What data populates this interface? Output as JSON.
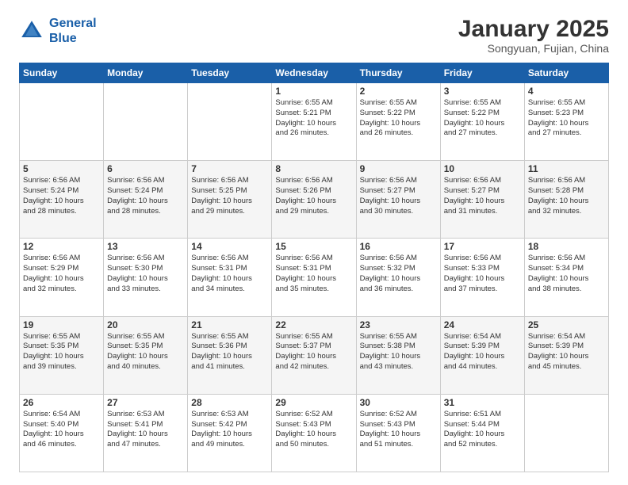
{
  "header": {
    "logo_line1": "General",
    "logo_line2": "Blue",
    "month": "January 2025",
    "location": "Songyuan, Fujian, China"
  },
  "weekdays": [
    "Sunday",
    "Monday",
    "Tuesday",
    "Wednesday",
    "Thursday",
    "Friday",
    "Saturday"
  ],
  "weeks": [
    [
      {
        "day": "",
        "info": ""
      },
      {
        "day": "",
        "info": ""
      },
      {
        "day": "",
        "info": ""
      },
      {
        "day": "1",
        "info": "Sunrise: 6:55 AM\nSunset: 5:21 PM\nDaylight: 10 hours\nand 26 minutes."
      },
      {
        "day": "2",
        "info": "Sunrise: 6:55 AM\nSunset: 5:22 PM\nDaylight: 10 hours\nand 26 minutes."
      },
      {
        "day": "3",
        "info": "Sunrise: 6:55 AM\nSunset: 5:22 PM\nDaylight: 10 hours\nand 27 minutes."
      },
      {
        "day": "4",
        "info": "Sunrise: 6:55 AM\nSunset: 5:23 PM\nDaylight: 10 hours\nand 27 minutes."
      }
    ],
    [
      {
        "day": "5",
        "info": "Sunrise: 6:56 AM\nSunset: 5:24 PM\nDaylight: 10 hours\nand 28 minutes."
      },
      {
        "day": "6",
        "info": "Sunrise: 6:56 AM\nSunset: 5:24 PM\nDaylight: 10 hours\nand 28 minutes."
      },
      {
        "day": "7",
        "info": "Sunrise: 6:56 AM\nSunset: 5:25 PM\nDaylight: 10 hours\nand 29 minutes."
      },
      {
        "day": "8",
        "info": "Sunrise: 6:56 AM\nSunset: 5:26 PM\nDaylight: 10 hours\nand 29 minutes."
      },
      {
        "day": "9",
        "info": "Sunrise: 6:56 AM\nSunset: 5:27 PM\nDaylight: 10 hours\nand 30 minutes."
      },
      {
        "day": "10",
        "info": "Sunrise: 6:56 AM\nSunset: 5:27 PM\nDaylight: 10 hours\nand 31 minutes."
      },
      {
        "day": "11",
        "info": "Sunrise: 6:56 AM\nSunset: 5:28 PM\nDaylight: 10 hours\nand 32 minutes."
      }
    ],
    [
      {
        "day": "12",
        "info": "Sunrise: 6:56 AM\nSunset: 5:29 PM\nDaylight: 10 hours\nand 32 minutes."
      },
      {
        "day": "13",
        "info": "Sunrise: 6:56 AM\nSunset: 5:30 PM\nDaylight: 10 hours\nand 33 minutes."
      },
      {
        "day": "14",
        "info": "Sunrise: 6:56 AM\nSunset: 5:31 PM\nDaylight: 10 hours\nand 34 minutes."
      },
      {
        "day": "15",
        "info": "Sunrise: 6:56 AM\nSunset: 5:31 PM\nDaylight: 10 hours\nand 35 minutes."
      },
      {
        "day": "16",
        "info": "Sunrise: 6:56 AM\nSunset: 5:32 PM\nDaylight: 10 hours\nand 36 minutes."
      },
      {
        "day": "17",
        "info": "Sunrise: 6:56 AM\nSunset: 5:33 PM\nDaylight: 10 hours\nand 37 minutes."
      },
      {
        "day": "18",
        "info": "Sunrise: 6:56 AM\nSunset: 5:34 PM\nDaylight: 10 hours\nand 38 minutes."
      }
    ],
    [
      {
        "day": "19",
        "info": "Sunrise: 6:55 AM\nSunset: 5:35 PM\nDaylight: 10 hours\nand 39 minutes."
      },
      {
        "day": "20",
        "info": "Sunrise: 6:55 AM\nSunset: 5:35 PM\nDaylight: 10 hours\nand 40 minutes."
      },
      {
        "day": "21",
        "info": "Sunrise: 6:55 AM\nSunset: 5:36 PM\nDaylight: 10 hours\nand 41 minutes."
      },
      {
        "day": "22",
        "info": "Sunrise: 6:55 AM\nSunset: 5:37 PM\nDaylight: 10 hours\nand 42 minutes."
      },
      {
        "day": "23",
        "info": "Sunrise: 6:55 AM\nSunset: 5:38 PM\nDaylight: 10 hours\nand 43 minutes."
      },
      {
        "day": "24",
        "info": "Sunrise: 6:54 AM\nSunset: 5:39 PM\nDaylight: 10 hours\nand 44 minutes."
      },
      {
        "day": "25",
        "info": "Sunrise: 6:54 AM\nSunset: 5:39 PM\nDaylight: 10 hours\nand 45 minutes."
      }
    ],
    [
      {
        "day": "26",
        "info": "Sunrise: 6:54 AM\nSunset: 5:40 PM\nDaylight: 10 hours\nand 46 minutes."
      },
      {
        "day": "27",
        "info": "Sunrise: 6:53 AM\nSunset: 5:41 PM\nDaylight: 10 hours\nand 47 minutes."
      },
      {
        "day": "28",
        "info": "Sunrise: 6:53 AM\nSunset: 5:42 PM\nDaylight: 10 hours\nand 49 minutes."
      },
      {
        "day": "29",
        "info": "Sunrise: 6:52 AM\nSunset: 5:43 PM\nDaylight: 10 hours\nand 50 minutes."
      },
      {
        "day": "30",
        "info": "Sunrise: 6:52 AM\nSunset: 5:43 PM\nDaylight: 10 hours\nand 51 minutes."
      },
      {
        "day": "31",
        "info": "Sunrise: 6:51 AM\nSunset: 5:44 PM\nDaylight: 10 hours\nand 52 minutes."
      },
      {
        "day": "",
        "info": ""
      }
    ]
  ]
}
